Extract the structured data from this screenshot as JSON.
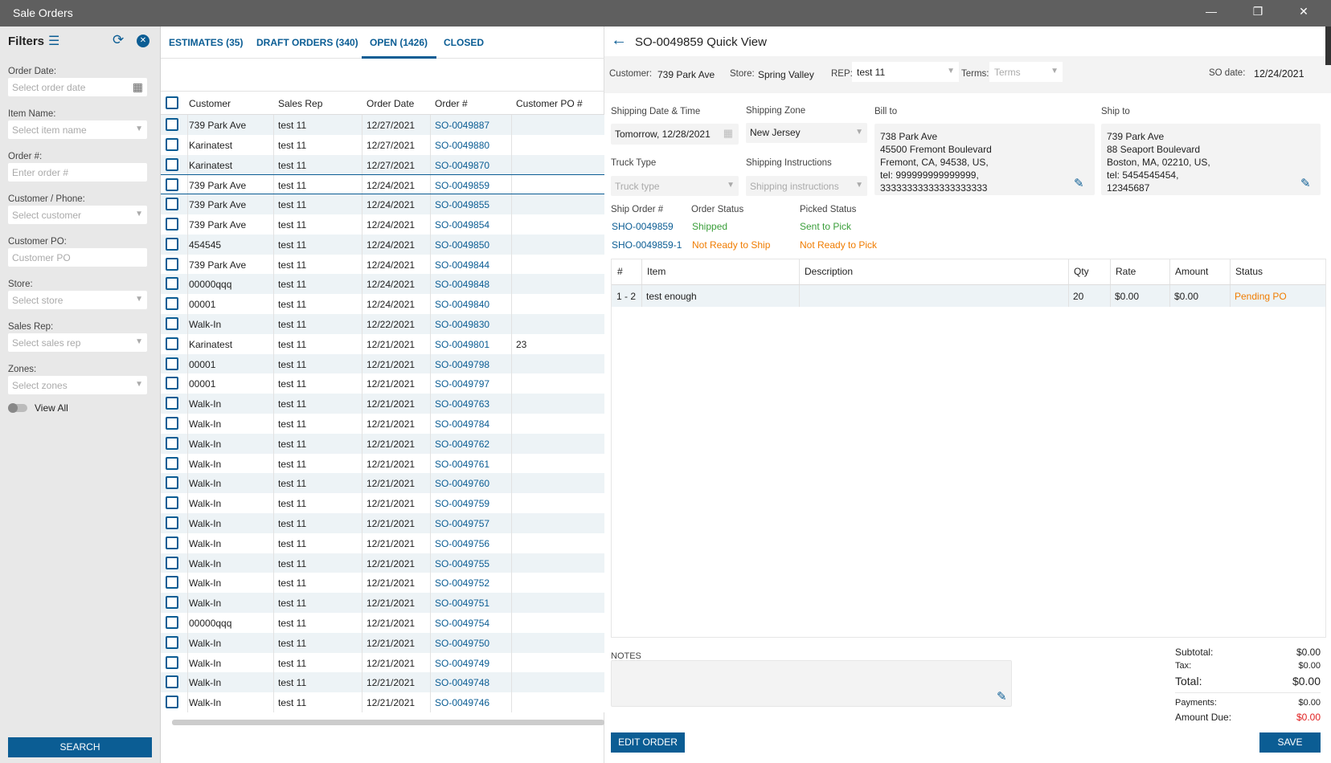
{
  "window": {
    "title": "Sale Orders"
  },
  "filters": {
    "title": "Filters",
    "fields": [
      {
        "label": "Order Date:",
        "placeholder": "Select order date",
        "icon": "calendar-icon"
      },
      {
        "label": "Item Name:",
        "placeholder": "Select item name",
        "icon": "chevron-down-icon"
      },
      {
        "label": "Order #:",
        "placeholder": "Enter order #"
      },
      {
        "label": "Customer / Phone:",
        "placeholder": "Select customer",
        "icon": "chevron-down-icon"
      },
      {
        "label": "Customer PO:",
        "placeholder": "Customer PO"
      },
      {
        "label": "Store:",
        "placeholder": "Select store",
        "icon": "chevron-down-icon"
      },
      {
        "label": "Sales Rep:",
        "placeholder": "Select sales rep",
        "icon": "chevron-down-icon"
      },
      {
        "label": "Zones:",
        "placeholder": "Select zones",
        "icon": "chevron-down-icon"
      }
    ],
    "view_all": "View All",
    "view_all_on": false,
    "search": "SEARCH"
  },
  "tabs": [
    {
      "label": "ESTIMATES (35)"
    },
    {
      "label": "DRAFT ORDERS (340)"
    },
    {
      "label": "OPEN (1426)",
      "active": true
    },
    {
      "label": "CLOSED"
    }
  ],
  "table": {
    "columns": [
      "Customer",
      "Sales Rep",
      "Order Date",
      "Order #",
      "Customer PO #"
    ],
    "selected_index": 3,
    "rows": [
      [
        "739 Park Ave",
        "test 11",
        "12/27/2021",
        "SO-0049887",
        ""
      ],
      [
        "Karinatest",
        "test 11",
        "12/27/2021",
        "SO-0049880",
        ""
      ],
      [
        "Karinatest",
        "test 11",
        "12/27/2021",
        "SO-0049870",
        ""
      ],
      [
        "739 Park Ave",
        "test 11",
        "12/24/2021",
        "SO-0049859",
        ""
      ],
      [
        "739 Park Ave",
        "test 11",
        "12/24/2021",
        "SO-0049855",
        ""
      ],
      [
        "739 Park Ave",
        "test 11",
        "12/24/2021",
        "SO-0049854",
        ""
      ],
      [
        "454545",
        "test 11",
        "12/24/2021",
        "SO-0049850",
        ""
      ],
      [
        "739 Park Ave",
        "test 11",
        "12/24/2021",
        "SO-0049844",
        ""
      ],
      [
        "00000qqq",
        "test 11",
        "12/24/2021",
        "SO-0049848",
        ""
      ],
      [
        "00001",
        "test 11",
        "12/24/2021",
        "SO-0049840",
        ""
      ],
      [
        "Walk-In",
        "test 11",
        "12/22/2021",
        "SO-0049830",
        ""
      ],
      [
        "Karinatest",
        "test 11",
        "12/21/2021",
        "SO-0049801",
        "23"
      ],
      [
        "00001",
        "test 11",
        "12/21/2021",
        "SO-0049798",
        ""
      ],
      [
        "00001",
        "test 11",
        "12/21/2021",
        "SO-0049797",
        ""
      ],
      [
        "Walk-In",
        "test 11",
        "12/21/2021",
        "SO-0049763",
        ""
      ],
      [
        "Walk-In",
        "test 11",
        "12/21/2021",
        "SO-0049784",
        ""
      ],
      [
        "Walk-In",
        "test 11",
        "12/21/2021",
        "SO-0049762",
        ""
      ],
      [
        "Walk-In",
        "test 11",
        "12/21/2021",
        "SO-0049761",
        ""
      ],
      [
        "Walk-In",
        "test 11",
        "12/21/2021",
        "SO-0049760",
        ""
      ],
      [
        "Walk-In",
        "test 11",
        "12/21/2021",
        "SO-0049759",
        ""
      ],
      [
        "Walk-In",
        "test 11",
        "12/21/2021",
        "SO-0049757",
        ""
      ],
      [
        "Walk-In",
        "test 11",
        "12/21/2021",
        "SO-0049756",
        ""
      ],
      [
        "Walk-In",
        "test 11",
        "12/21/2021",
        "SO-0049755",
        ""
      ],
      [
        "Walk-In",
        "test 11",
        "12/21/2021",
        "SO-0049752",
        ""
      ],
      [
        "Walk-In",
        "test 11",
        "12/21/2021",
        "SO-0049751",
        ""
      ],
      [
        "00000qqq",
        "test 11",
        "12/21/2021",
        "SO-0049754",
        ""
      ],
      [
        "Walk-In",
        "test 11",
        "12/21/2021",
        "SO-0049750",
        ""
      ],
      [
        "Walk-In",
        "test 11",
        "12/21/2021",
        "SO-0049749",
        ""
      ],
      [
        "Walk-In",
        "test 11",
        "12/21/2021",
        "SO-0049748",
        ""
      ],
      [
        "Walk-In",
        "test 11",
        "12/21/2021",
        "SO-0049746",
        ""
      ]
    ]
  },
  "quick_view": {
    "title": "SO-0049859  Quick View",
    "customer_label": "Customer:",
    "customer": "739 Park Ave",
    "store_label": "Store:",
    "store": "Spring Valley",
    "rep_label": "REP:",
    "rep": "test 11",
    "terms_label": "Terms:",
    "terms_placeholder": "Terms",
    "so_date_label": "SO date:",
    "so_date": "12/24/2021",
    "shipping_date_label": "Shipping Date & Time",
    "shipping_date": "Tomorrow, 12/28/2021",
    "shipping_zone_label": "Shipping Zone",
    "shipping_zone": "New Jersey",
    "truck_type_label": "Truck Type",
    "truck_type_placeholder": "Truck type",
    "shipping_instr_label": "Shipping Instructions",
    "shipping_instr_placeholder": "Shipping instructions",
    "bill_to_label": "Bill to",
    "bill_to": [
      "738 Park Ave",
      "45500 Fremont Boulevard",
      "Fremont, CA, 94538, US,",
      "tel: 999999999999999,",
      "33333333333333333333"
    ],
    "ship_to_label": "Ship to",
    "ship_to": [
      "739 Park Ave",
      "88 Seaport Boulevard",
      "Boston, MA, 02210, US,",
      "tel: 5454545454,",
      "12345687"
    ],
    "ship_headers": [
      "Ship Order #",
      "Order Status",
      "Picked Status"
    ],
    "ship_orders": [
      {
        "id": "SHO-0049859",
        "order_status": "Shipped",
        "picked_status": "Sent to Pick"
      },
      {
        "id": "SHO-0049859-1",
        "order_status": "Not Ready to Ship",
        "picked_status": "Not Ready to Pick"
      }
    ],
    "item_columns": [
      "#",
      "Item",
      "Description",
      "Qty",
      "Rate",
      "Amount",
      "Status"
    ],
    "items": [
      [
        "1 - 2",
        "test enough",
        "",
        "20",
        "$0.00",
        "$0.00",
        "Pending PO"
      ]
    ],
    "notes_label": "NOTES",
    "totals": {
      "subtotal_label": "Subtotal:",
      "subtotal": "$0.00",
      "tax_label": "Tax:",
      "tax": "$0.00",
      "total_label": "Total:",
      "total": "$0.00",
      "payments_label": "Payments:",
      "payments": "$0.00",
      "due_label": "Amount Due:",
      "due": "$0.00"
    },
    "edit_order": "EDIT ORDER",
    "save": "SAVE"
  },
  "colors": {
    "accent": "#0b5d94",
    "shipped": "#3a9e3a",
    "warning": "#f07c00",
    "due": "#e02020"
  }
}
